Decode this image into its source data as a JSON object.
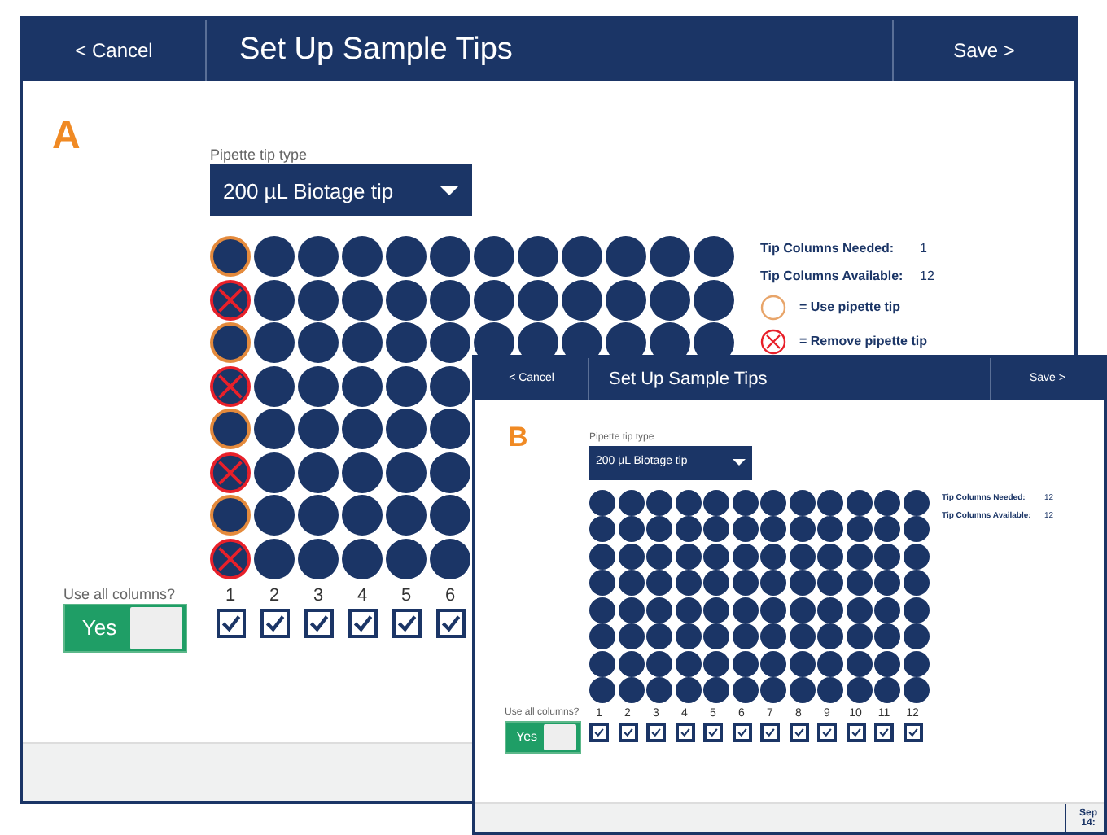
{
  "windows": [
    {
      "kind": "large",
      "marker": "A",
      "header": {
        "cancel": "< Cancel",
        "title": "Set Up Sample Tips",
        "save": "Save >"
      },
      "tip_type": {
        "label": "Pipette tip type",
        "value": "200 µL Biotage tip"
      },
      "columns": [
        {
          "label": "1",
          "checked": true,
          "wells": [
            {
              "kind": "use"
            },
            {
              "kind": "remove"
            },
            {
              "kind": "use"
            },
            {
              "kind": "remove"
            },
            {
              "kind": "use"
            },
            {
              "kind": "remove"
            },
            {
              "kind": "use"
            },
            {
              "kind": "remove"
            }
          ]
        },
        {
          "label": "2",
          "checked": true,
          "wells": [
            {
              "kind": "plain"
            },
            {
              "kind": "plain"
            },
            {
              "kind": "plain"
            },
            {
              "kind": "plain"
            },
            {
              "kind": "plain"
            },
            {
              "kind": "plain"
            },
            {
              "kind": "plain"
            },
            {
              "kind": "plain"
            }
          ]
        },
        {
          "label": "3",
          "checked": true,
          "wells": [
            {
              "kind": "plain"
            },
            {
              "kind": "plain"
            },
            {
              "kind": "plain"
            },
            {
              "kind": "plain"
            },
            {
              "kind": "plain"
            },
            {
              "kind": "plain"
            },
            {
              "kind": "plain"
            },
            {
              "kind": "plain"
            }
          ]
        },
        {
          "label": "4",
          "checked": true,
          "wells": [
            {
              "kind": "plain"
            },
            {
              "kind": "plain"
            },
            {
              "kind": "plain"
            },
            {
              "kind": "plain"
            },
            {
              "kind": "plain"
            },
            {
              "kind": "plain"
            },
            {
              "kind": "plain"
            },
            {
              "kind": "plain"
            }
          ]
        },
        {
          "label": "5",
          "checked": true,
          "wells": [
            {
              "kind": "plain"
            },
            {
              "kind": "plain"
            },
            {
              "kind": "plain"
            },
            {
              "kind": "plain"
            },
            {
              "kind": "plain"
            },
            {
              "kind": "plain"
            },
            {
              "kind": "plain"
            },
            {
              "kind": "plain"
            }
          ]
        },
        {
          "label": "6",
          "checked": true,
          "wells": [
            {
              "kind": "plain"
            },
            {
              "kind": "plain"
            },
            {
              "kind": "plain"
            },
            {
              "kind": "plain"
            },
            {
              "kind": "plain"
            },
            {
              "kind": "plain"
            },
            {
              "kind": "plain"
            },
            {
              "kind": "plain"
            }
          ]
        },
        {
          "wells": [
            {
              "kind": "plain"
            },
            {
              "kind": "plain"
            },
            {
              "kind": "plain"
            }
          ]
        },
        {
          "wells": [
            {
              "kind": "plain"
            },
            {
              "kind": "plain"
            },
            {
              "kind": "plain"
            }
          ]
        },
        {
          "wells": [
            {
              "kind": "plain"
            },
            {
              "kind": "plain"
            },
            {
              "kind": "plain"
            }
          ]
        },
        {
          "wells": [
            {
              "kind": "plain"
            },
            {
              "kind": "plain"
            },
            {
              "kind": "plain"
            }
          ]
        },
        {
          "wells": [
            {
              "kind": "plain"
            },
            {
              "kind": "plain"
            },
            {
              "kind": "plain"
            }
          ]
        },
        {
          "wells": [
            {
              "kind": "plain"
            },
            {
              "kind": "plain"
            },
            {
              "kind": "plain"
            }
          ]
        }
      ],
      "stats": [
        {
          "label": "Tip Columns Needed:",
          "value": "1"
        },
        {
          "label": "Tip Columns Available:",
          "value": "12"
        }
      ],
      "legend": [
        {
          "kind": "use",
          "label": "= Use pipette tip"
        },
        {
          "kind": "remove",
          "label": "= Remove pipette tip"
        }
      ],
      "use_all": {
        "label": "Use all columns?",
        "value": "Yes",
        "on": true
      }
    },
    {
      "kind": "small",
      "marker": "B",
      "header": {
        "cancel": "< Cancel",
        "title": "Set Up Sample Tips",
        "save": "Save >"
      },
      "tip_type": {
        "label": "Pipette tip type",
        "value": "200 µL Biotage tip"
      },
      "columns": [
        {
          "label": "1",
          "checked": true,
          "wells": [
            {
              "kind": "plain"
            },
            {
              "kind": "plain"
            },
            {
              "kind": "plain"
            },
            {
              "kind": "plain"
            },
            {
              "kind": "plain"
            },
            {
              "kind": "plain"
            },
            {
              "kind": "plain"
            },
            {
              "kind": "plain"
            }
          ]
        },
        {
          "label": "2",
          "checked": true,
          "wells": [
            {
              "kind": "plain"
            },
            {
              "kind": "plain"
            },
            {
              "kind": "plain"
            },
            {
              "kind": "plain"
            },
            {
              "kind": "plain"
            },
            {
              "kind": "plain"
            },
            {
              "kind": "plain"
            },
            {
              "kind": "plain"
            }
          ]
        },
        {
          "label": "3",
          "checked": true,
          "wells": [
            {
              "kind": "plain"
            },
            {
              "kind": "plain"
            },
            {
              "kind": "plain"
            },
            {
              "kind": "plain"
            },
            {
              "kind": "plain"
            },
            {
              "kind": "plain"
            },
            {
              "kind": "plain"
            },
            {
              "kind": "plain"
            }
          ]
        },
        {
          "label": "4",
          "checked": true,
          "wells": [
            {
              "kind": "plain"
            },
            {
              "kind": "plain"
            },
            {
              "kind": "plain"
            },
            {
              "kind": "plain"
            },
            {
              "kind": "plain"
            },
            {
              "kind": "plain"
            },
            {
              "kind": "plain"
            },
            {
              "kind": "plain"
            }
          ]
        },
        {
          "label": "5",
          "checked": true,
          "wells": [
            {
              "kind": "plain"
            },
            {
              "kind": "plain"
            },
            {
              "kind": "plain"
            },
            {
              "kind": "plain"
            },
            {
              "kind": "plain"
            },
            {
              "kind": "plain"
            },
            {
              "kind": "plain"
            },
            {
              "kind": "plain"
            }
          ]
        },
        {
          "label": "6",
          "checked": true,
          "wells": [
            {
              "kind": "plain"
            },
            {
              "kind": "plain"
            },
            {
              "kind": "plain"
            },
            {
              "kind": "plain"
            },
            {
              "kind": "plain"
            },
            {
              "kind": "plain"
            },
            {
              "kind": "plain"
            },
            {
              "kind": "plain"
            }
          ]
        },
        {
          "label": "7",
          "checked": true,
          "wells": [
            {
              "kind": "plain"
            },
            {
              "kind": "plain"
            },
            {
              "kind": "plain"
            },
            {
              "kind": "plain"
            },
            {
              "kind": "plain"
            },
            {
              "kind": "plain"
            },
            {
              "kind": "plain"
            },
            {
              "kind": "plain"
            }
          ]
        },
        {
          "label": "8",
          "checked": true,
          "wells": [
            {
              "kind": "plain"
            },
            {
              "kind": "plain"
            },
            {
              "kind": "plain"
            },
            {
              "kind": "plain"
            },
            {
              "kind": "plain"
            },
            {
              "kind": "plain"
            },
            {
              "kind": "plain"
            },
            {
              "kind": "plain"
            }
          ]
        },
        {
          "label": "9",
          "checked": true,
          "wells": [
            {
              "kind": "plain"
            },
            {
              "kind": "plain"
            },
            {
              "kind": "plain"
            },
            {
              "kind": "plain"
            },
            {
              "kind": "plain"
            },
            {
              "kind": "plain"
            },
            {
              "kind": "plain"
            },
            {
              "kind": "plain"
            }
          ]
        },
        {
          "label": "10",
          "checked": true,
          "wells": [
            {
              "kind": "plain"
            },
            {
              "kind": "plain"
            },
            {
              "kind": "plain"
            },
            {
              "kind": "plain"
            },
            {
              "kind": "plain"
            },
            {
              "kind": "plain"
            },
            {
              "kind": "plain"
            },
            {
              "kind": "plain"
            }
          ]
        },
        {
          "label": "11",
          "checked": true,
          "wells": [
            {
              "kind": "plain"
            },
            {
              "kind": "plain"
            },
            {
              "kind": "plain"
            },
            {
              "kind": "plain"
            },
            {
              "kind": "plain"
            },
            {
              "kind": "plain"
            },
            {
              "kind": "plain"
            },
            {
              "kind": "plain"
            }
          ]
        },
        {
          "label": "12",
          "checked": true,
          "wells": [
            {
              "kind": "plain"
            },
            {
              "kind": "plain"
            },
            {
              "kind": "plain"
            },
            {
              "kind": "plain"
            },
            {
              "kind": "plain"
            },
            {
              "kind": "plain"
            },
            {
              "kind": "plain"
            },
            {
              "kind": "plain"
            }
          ]
        }
      ],
      "stats": [
        {
          "label": "Tip Columns Needed:",
          "value": "12"
        },
        {
          "label": "Tip Columns Available:",
          "value": "12"
        }
      ],
      "use_all": {
        "label": "Use all columns?",
        "value": "Yes",
        "on": true
      },
      "footer": {
        "date": "Sep",
        "time": "14:"
      }
    }
  ]
}
